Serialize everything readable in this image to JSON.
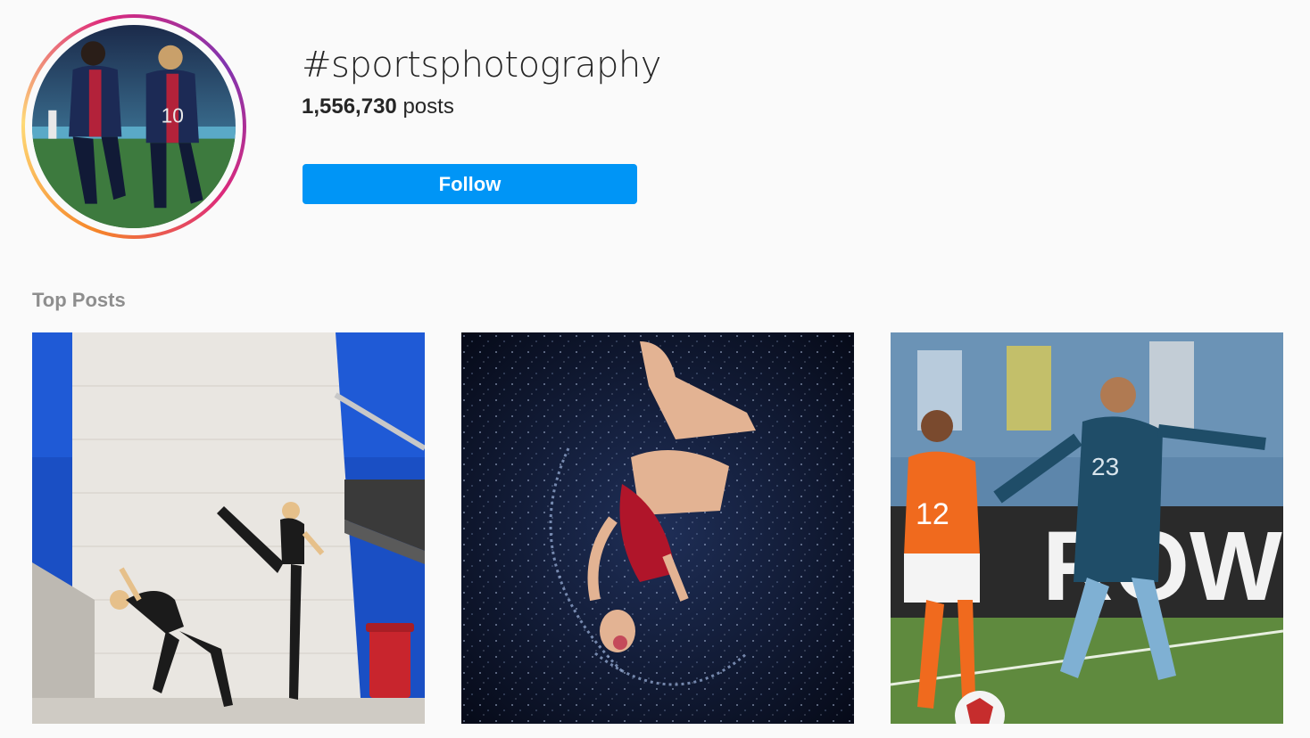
{
  "hashtag": {
    "name": "#sportsphotography",
    "post_count": "1,556,730",
    "post_count_suffix": "posts",
    "follow_label": "Follow"
  },
  "colors": {
    "follow_button": "#0095f6",
    "section_title": "#8e8e8e",
    "background": "#fafafa"
  },
  "avatar": {
    "description_icon": "soccer-players-photo"
  },
  "top_posts": {
    "title": "Top Posts",
    "posts": [
      {
        "icon": "dancers-photo"
      },
      {
        "icon": "synchronized-swimmer-photo"
      },
      {
        "icon": "womens-soccer-photo"
      }
    ]
  }
}
